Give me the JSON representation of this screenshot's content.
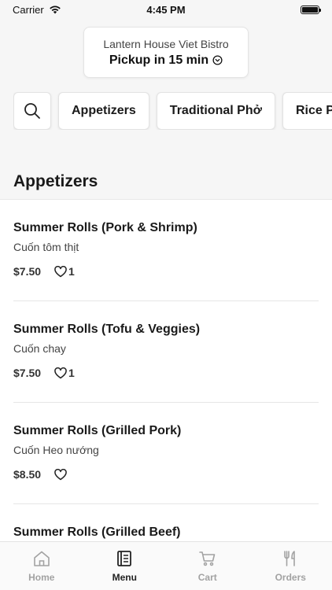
{
  "status_bar": {
    "carrier": "Carrier",
    "time": "4:45 PM",
    "battery_level": 1.0
  },
  "header": {
    "restaurant_name": "Lantern House Viet Bistro",
    "pickup_label": "Pickup in 15 min"
  },
  "categories": {
    "search_icon": "search-icon",
    "items": [
      "Appetizers",
      "Traditional Phở",
      "Rice Plates"
    ]
  },
  "section": {
    "title": "Appetizers"
  },
  "menu_items": [
    {
      "name": "Summer Rolls (Pork & Shrimp)",
      "description": "Cuốn tôm thịt",
      "price": "$7.50",
      "likes": "1"
    },
    {
      "name": "Summer Rolls (Tofu & Veggies)",
      "description": "Cuốn chay",
      "price": "$7.50",
      "likes": "1"
    },
    {
      "name": "Summer Rolls (Grilled Pork)",
      "description": "Cuốn Heo nướng",
      "price": "$8.50",
      "likes": ""
    },
    {
      "name": "Summer Rolls (Grilled Beef)",
      "description": "",
      "price": "",
      "likes": ""
    }
  ],
  "tab_bar": {
    "tabs": [
      {
        "label": "Home",
        "icon": "home-icon",
        "active": false
      },
      {
        "label": "Menu",
        "icon": "menu-icon",
        "active": true
      },
      {
        "label": "Cart",
        "icon": "cart-icon",
        "active": false
      },
      {
        "label": "Orders",
        "icon": "orders-icon",
        "active": false
      }
    ]
  },
  "colors": {
    "background": "#f6f6f6",
    "text_primary": "#1a1a1a",
    "tab_inactive": "#a2a2a2",
    "tab_active": "#222222"
  }
}
